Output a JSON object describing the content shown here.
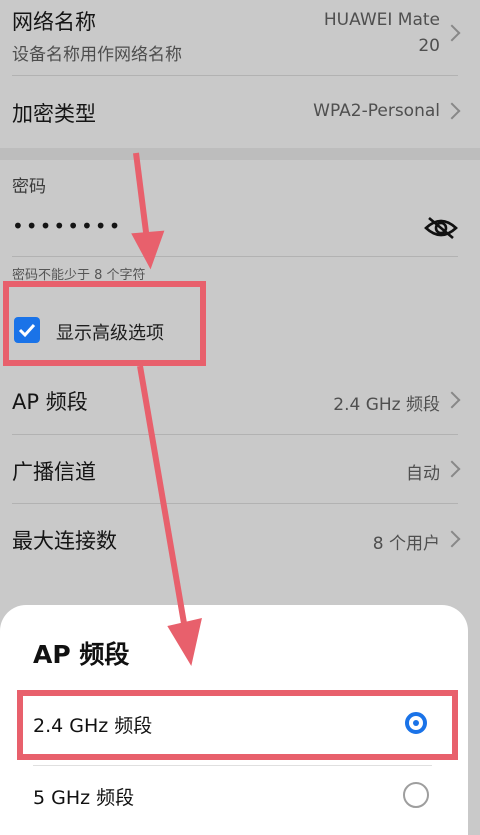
{
  "settings": {
    "network_name_label": "网络名称",
    "network_name_sub": "设备名称用作网络名称",
    "network_name_value_line1": "HUAWEI Mate",
    "network_name_value_line2": "20",
    "encryption_label": "加密类型",
    "encryption_value": "WPA2-Personal",
    "password_label": "密码",
    "password_value": "••••••••",
    "password_hint": "密码不能少于 8 个字符",
    "advanced_label": "显示高级选项",
    "advanced_checked": true,
    "ap_band_label": "AP 频段",
    "ap_band_value": "2.4 GHz 频段",
    "channel_label": "广播信道",
    "channel_value": "自动",
    "max_conn_label": "最大连接数",
    "max_conn_value": "8 个用户"
  },
  "sheet": {
    "title": "AP 频段",
    "options": [
      {
        "label": "2.4 GHz 频段",
        "selected": true
      },
      {
        "label": "5 GHz 频段",
        "selected": false
      }
    ]
  },
  "colors": {
    "accent": "#1a73e8",
    "annotation": "#e8606c",
    "dim_background": "#c9c9c9"
  }
}
